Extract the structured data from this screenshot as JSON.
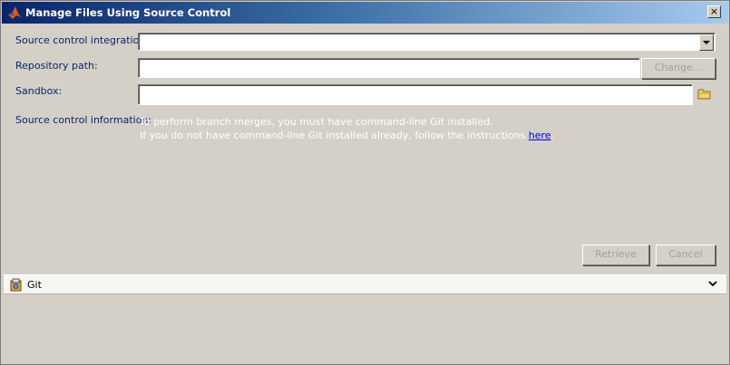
{
  "window": {
    "title": "Manage Files Using Source Control",
    "close_glyph": "×"
  },
  "form": {
    "integration_label": "Source control integration:",
    "integration_value": "",
    "repo_label": "Repository path:",
    "repo_value": "",
    "change_button": "Change...",
    "sandbox_label": "Sandbox:",
    "sandbox_value": "",
    "info_label": "Source control information:",
    "info_line1": "To perform branch merges, you must have command-line Git installed.",
    "info_line2_prefix": "If you do not have command-line Git installed already, follow the instructions ",
    "info_link": "here"
  },
  "actions": {
    "retrieve": "Retrieve",
    "cancel": "Cancel"
  },
  "git_panel": {
    "label": "Git"
  },
  "icons": {
    "app": "matlab-logo-icon",
    "folder": "folder-icon",
    "git": "git-icon",
    "chevron": "chevron-down-icon"
  },
  "colors": {
    "label_text": "#0a246a",
    "info_text": "#ffffff",
    "link": "#0000ee",
    "title_gradient_start": "#0a246a",
    "title_gradient_end": "#a6caf0"
  }
}
